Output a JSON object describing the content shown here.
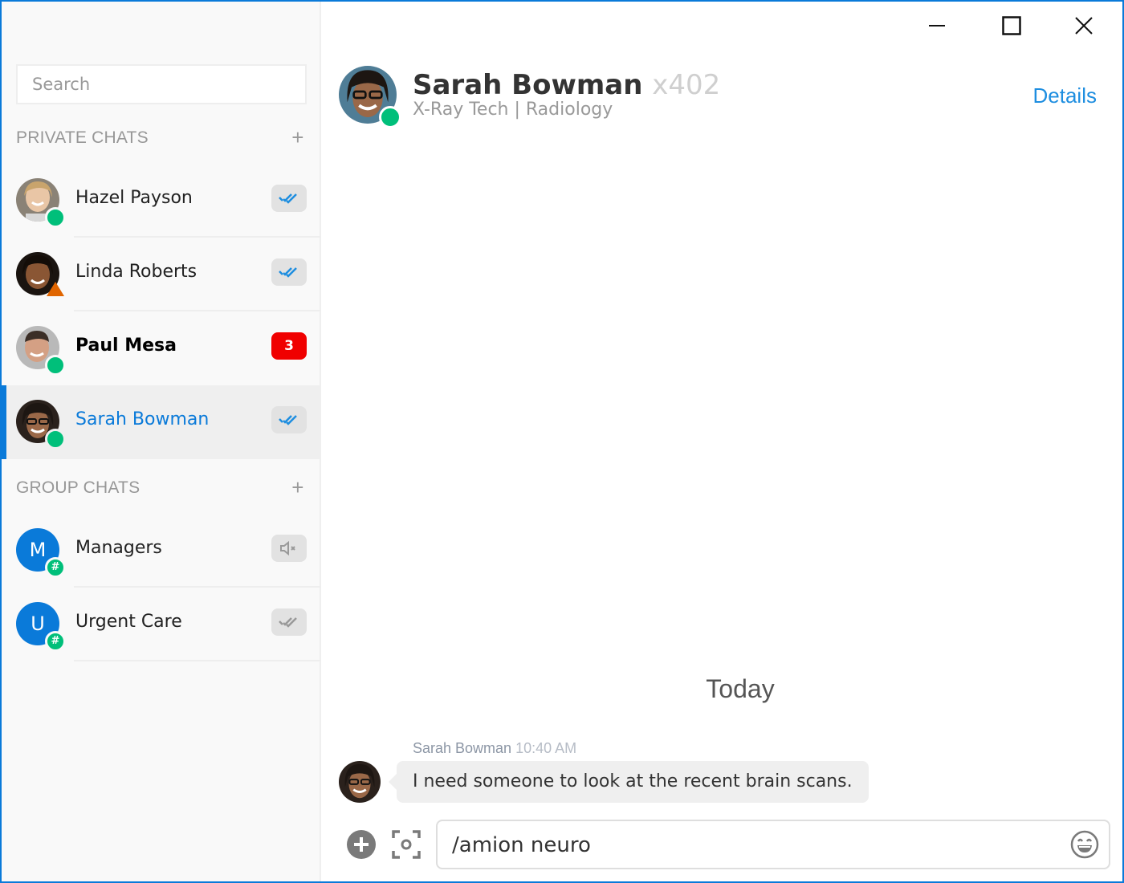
{
  "window": {
    "controls": {
      "minimize": "minimize",
      "maximize": "maximize",
      "close": "close"
    }
  },
  "sidebar": {
    "search": {
      "placeholder": "Search",
      "value": ""
    },
    "private_chats": {
      "title": "PRIVATE CHATS",
      "add_label": "+",
      "items": [
        {
          "name": "Hazel Payson",
          "status": "online",
          "indicator": "read-receipt",
          "active": false,
          "unread": false
        },
        {
          "name": "Linda Roberts",
          "status": "away",
          "indicator": "read-receipt",
          "active": false,
          "unread": false
        },
        {
          "name": "Paul Mesa",
          "status": "online",
          "indicator": "unread-count",
          "count": "3",
          "active": false,
          "unread": true
        },
        {
          "name": "Sarah Bowman",
          "status": "online",
          "indicator": "read-receipt",
          "active": true,
          "unread": false
        }
      ]
    },
    "group_chats": {
      "title": "GROUP CHATS",
      "add_label": "+",
      "items": [
        {
          "name": "Managers",
          "initial": "M",
          "badge": "#",
          "indicator": "muted"
        },
        {
          "name": "Urgent Care",
          "initial": "U",
          "badge": "#",
          "indicator": "read-receipt-gray"
        }
      ]
    }
  },
  "conversation": {
    "header": {
      "name": "Sarah Bowman",
      "extension": "x402",
      "subtitle": "X-Ray Tech | Radiology",
      "status": "online",
      "details_label": "Details"
    },
    "date_separator": "Today",
    "messages": [
      {
        "sender": "Sarah Bowman",
        "time": "10:40 AM",
        "text": "I need someone to look at the recent brain scans."
      }
    ],
    "composer": {
      "value": "/amion neuro",
      "placeholder": ""
    }
  },
  "colors": {
    "accent": "#0a7ad9",
    "online": "#00bf7a",
    "away": "#e06500",
    "unread_badge": "#f00000"
  }
}
